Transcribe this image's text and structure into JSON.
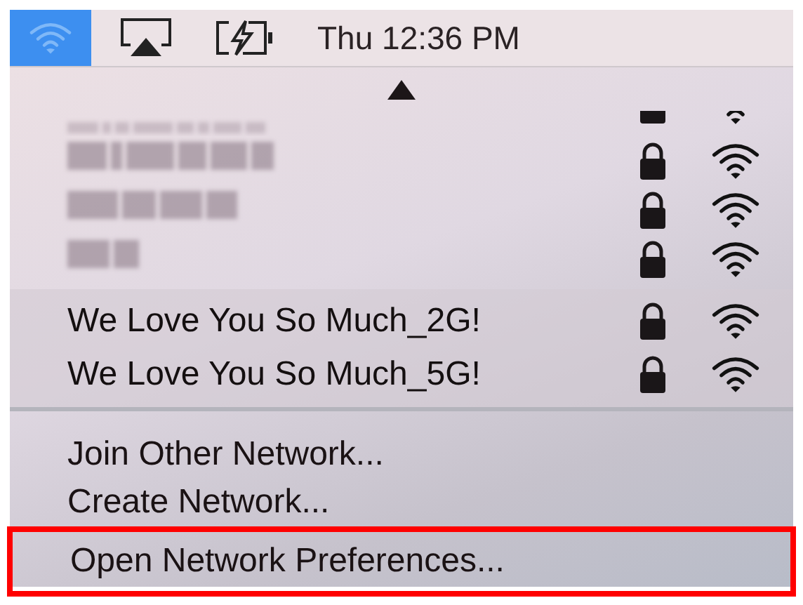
{
  "menu_bar": {
    "wifi_selected": true,
    "clock": "Thu 12:36 PM"
  },
  "obscured_networks": [
    {
      "locked": true,
      "partial": true
    },
    {
      "locked": true,
      "partial": false
    },
    {
      "locked": true,
      "partial": false
    },
    {
      "locked": true,
      "partial": false
    }
  ],
  "networks": [
    {
      "name": "We Love You So Much_2G!",
      "locked": true
    },
    {
      "name": "We Love You So Much_5G!",
      "locked": true
    }
  ],
  "actions": [
    {
      "label": "Join Other Network...",
      "highlighted": false
    },
    {
      "label": "Create Network...",
      "highlighted": false
    },
    {
      "label": "Open Network Preferences...",
      "highlighted": true
    }
  ]
}
